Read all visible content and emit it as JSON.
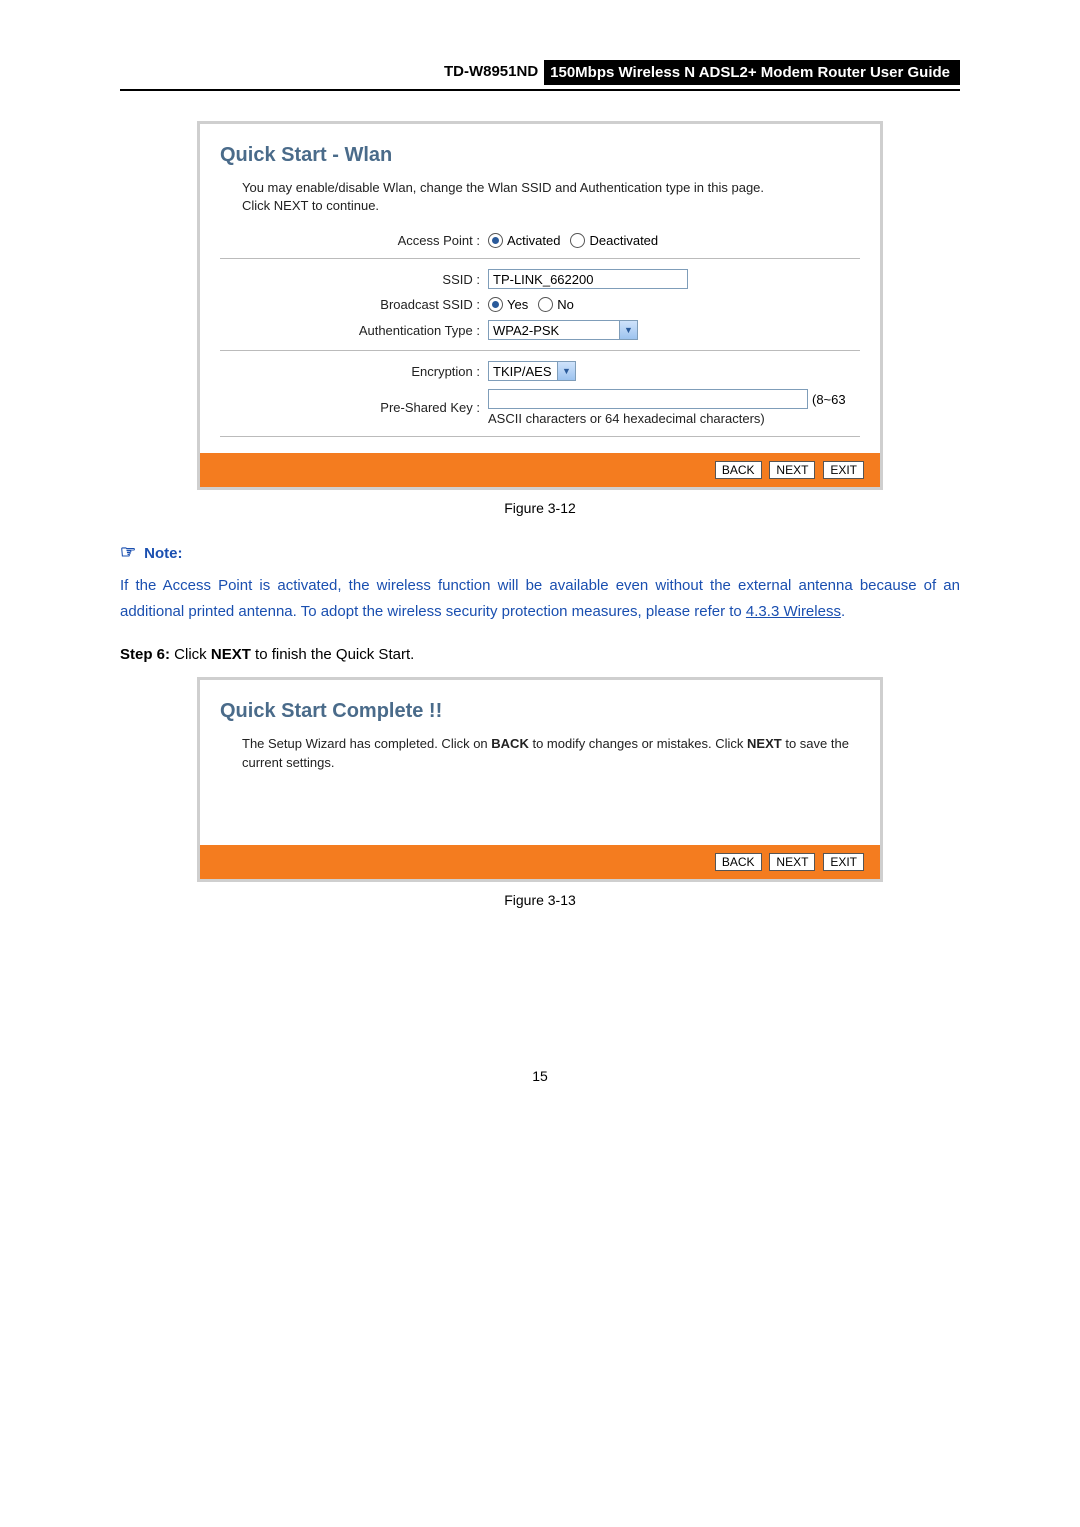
{
  "header": {
    "model": "TD-W8951ND",
    "title": "150Mbps Wireless N ADSL2+ Modem Router User Guide"
  },
  "panel1": {
    "heading": "Quick Start - Wlan",
    "intro_1": "You may enable/disable Wlan, change the Wlan SSID and Authentication type in this page.",
    "intro_2": "Click NEXT to continue.",
    "rows": {
      "ap_label": "Access Point :",
      "ap_activated": "Activated",
      "ap_deactivated": "Deactivated",
      "ssid_label": "SSID :",
      "ssid_value": "TP-LINK_662200",
      "bc_label": "Broadcast SSID :",
      "bc_yes": "Yes",
      "bc_no": "No",
      "auth_label": "Authentication Type :",
      "auth_value": "WPA2-PSK",
      "enc_label": "Encryption :",
      "enc_value": "TKIP/AES",
      "psk_label": "Pre-Shared Key :",
      "psk_value": "",
      "psk_suffix": "(8~63",
      "psk_hint": "ASCII characters or 64 hexadecimal characters)"
    },
    "buttons": {
      "back": "BACK",
      "next": "NEXT",
      "exit": "EXIT"
    }
  },
  "caption1": "Figure 3-12",
  "note": {
    "head": "Note:",
    "body_pre": "If the Access Point is activated, the wireless function will be available even without the external antenna because of an additional printed antenna. To adopt the wireless security protection measures, please refer to ",
    "link": "4.3.3 Wireless",
    "body_post": "."
  },
  "step6": {
    "label": "Step 6:",
    "rest_pre": "  Click ",
    "next": "NEXT",
    "rest_post": " to finish the Quick Start."
  },
  "panel2": {
    "heading": "Quick Start Complete !!",
    "body_1": "The Setup Wizard has completed. Click on ",
    "body_back": "BACK",
    "body_2": " to modify changes or mistakes. Click ",
    "body_next": "NEXT",
    "body_3": " to save the current settings.",
    "buttons": {
      "back": "BACK",
      "next": "NEXT",
      "exit": "EXIT"
    }
  },
  "caption2": "Figure 3-13",
  "pagenum": "15"
}
